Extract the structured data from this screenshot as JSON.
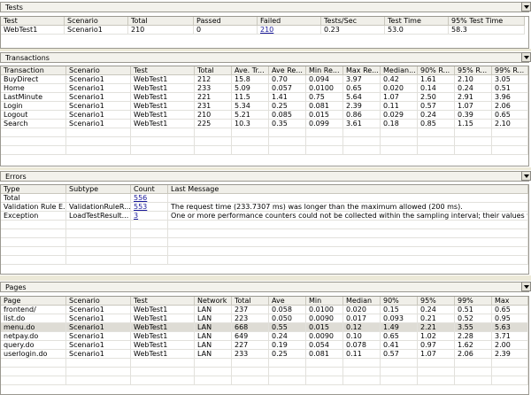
{
  "tests": {
    "title": "Tests",
    "columns": [
      "Test",
      "Scenario",
      "Total",
      "Passed",
      "Failed",
      "Tests/Sec",
      "Test Time",
      "95% Test Time"
    ],
    "rows": [
      [
        "WebTest1",
        "Scenario1",
        "210",
        "0",
        "210",
        "0.23",
        "53.0",
        "58.3"
      ]
    ]
  },
  "transactions": {
    "title": "Transactions",
    "columns": [
      "Transaction",
      "Scenario",
      "Test",
      "Total",
      "Ave. Tr...",
      "Ave Re...",
      "Min Re...",
      "Max Re...",
      "Median...",
      "90% R...",
      "95% R...",
      "99% R..."
    ],
    "rows": [
      [
        "BuyDirect",
        "Scenario1",
        "WebTest1",
        "212",
        "15.8",
        "0.70",
        "0.094",
        "3.97",
        "0.42",
        "1.61",
        "2.10",
        "3.05"
      ],
      [
        "Home",
        "Scenario1",
        "WebTest1",
        "233",
        "5.09",
        "0.057",
        "0.0100",
        "0.65",
        "0.020",
        "0.14",
        "0.24",
        "0.51"
      ],
      [
        "LastMinute",
        "Scenario1",
        "WebTest1",
        "221",
        "11.5",
        "1.41",
        "0.75",
        "5.64",
        "1.07",
        "2.50",
        "2.91",
        "3.96"
      ],
      [
        "Login",
        "Scenario1",
        "WebTest1",
        "231",
        "5.34",
        "0.25",
        "0.081",
        "2.39",
        "0.11",
        "0.57",
        "1.07",
        "2.06"
      ],
      [
        "Logout",
        "Scenario1",
        "WebTest1",
        "210",
        "5.21",
        "0.085",
        "0.015",
        "0.86",
        "0.029",
        "0.24",
        "0.39",
        "0.65"
      ],
      [
        "Search",
        "Scenario1",
        "WebTest1",
        "225",
        "10.3",
        "0.35",
        "0.099",
        "3.61",
        "0.18",
        "0.85",
        "1.15",
        "2.10"
      ]
    ]
  },
  "errors": {
    "title": "Errors",
    "columns": [
      "Type",
      "Subtype",
      "Count",
      "Last Message"
    ],
    "rows": [
      [
        "Total",
        "",
        "556",
        ""
      ],
      [
        "Validation Rule E...",
        "ValidationRuleR...",
        "553",
        "The request time (233.7307 ms) was longer than the maximum allowed (200 ms)."
      ],
      [
        "Exception",
        "LoadTestResult...",
        "3",
        "One or more performance counters could not be collected within the sampling interval; their values will not be graph"
      ]
    ]
  },
  "pages": {
    "title": "Pages",
    "columns": [
      "Page",
      "Scenario",
      "Test",
      "Network",
      "Total",
      "Ave",
      "Min",
      "Median",
      "90%",
      "95%",
      "99%",
      "Max"
    ],
    "rows": [
      [
        "frontend/",
        "Scenario1",
        "WebTest1",
        "LAN",
        "237",
        "0.058",
        "0.0100",
        "0.020",
        "0.15",
        "0.24",
        "0.51",
        "0.65"
      ],
      [
        "list.do",
        "Scenario1",
        "WebTest1",
        "LAN",
        "223",
        "0.050",
        "0.0090",
        "0.017",
        "0.093",
        "0.21",
        "0.52",
        "0.95"
      ],
      [
        "menu.do",
        "Scenario1",
        "WebTest1",
        "LAN",
        "668",
        "0.55",
        "0.015",
        "0.12",
        "1.49",
        "2.21",
        "3.55",
        "5.63"
      ],
      [
        "netpay.do",
        "Scenario1",
        "WebTest1",
        "LAN",
        "649",
        "0.24",
        "0.0090",
        "0.10",
        "0.65",
        "1.02",
        "2.28",
        "3.71"
      ],
      [
        "query.do",
        "Scenario1",
        "WebTest1",
        "LAN",
        "227",
        "0.19",
        "0.054",
        "0.078",
        "0.41",
        "0.97",
        "1.62",
        "2.00"
      ],
      [
        "userlogin.do",
        "Scenario1",
        "WebTest1",
        "LAN",
        "233",
        "0.25",
        "0.081",
        "0.11",
        "0.57",
        "1.07",
        "2.06",
        "2.39"
      ]
    ]
  }
}
